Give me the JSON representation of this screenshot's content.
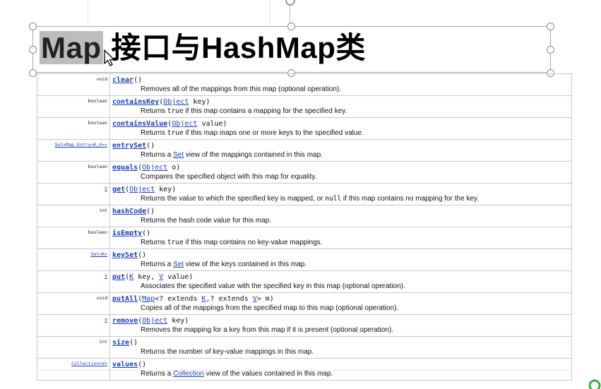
{
  "slide": {
    "title_selected": "Map",
    "title_rest": " 接口与HashMap类"
  },
  "methods": [
    {
      "type": "void",
      "name": "clear",
      "sig_before": "()",
      "desc": "Removes all of the mappings from this map (optional operation)."
    },
    {
      "type": "boolean",
      "name": "containsKey",
      "params": [
        {
          "t": "(",
          "plain": true
        },
        {
          "t": "Object",
          "link": true
        },
        {
          "t": " key)",
          "plain": true
        }
      ],
      "desc_parts": [
        {
          "t": "Returns "
        },
        {
          "t": "true",
          "code": true
        },
        {
          "t": " if this map contains a mapping for the specified key."
        }
      ]
    },
    {
      "type": "boolean",
      "name": "containsValue",
      "params": [
        {
          "t": "(",
          "plain": true
        },
        {
          "t": "Object",
          "link": true
        },
        {
          "t": " value)",
          "plain": true
        }
      ],
      "desc_parts": [
        {
          "t": "Returns "
        },
        {
          "t": "true",
          "code": true
        },
        {
          "t": " if this map maps one or more keys to the specified value."
        }
      ]
    },
    {
      "type": "Set<Map.Entry<K,V>>",
      "type_link": true,
      "name": "entrySet",
      "sig_before": "()",
      "desc_parts": [
        {
          "t": "Returns a "
        },
        {
          "t": "Set",
          "link": true
        },
        {
          "t": " view of the mappings contained in this map."
        }
      ]
    },
    {
      "type": "boolean",
      "name": "equals",
      "params": [
        {
          "t": "(",
          "plain": true
        },
        {
          "t": "Object",
          "link": true
        },
        {
          "t": " o)",
          "plain": true
        }
      ],
      "desc": "Compares the specified object with this map for equality."
    },
    {
      "type": "V",
      "type_link": true,
      "name": "get",
      "params": [
        {
          "t": "(",
          "plain": true
        },
        {
          "t": "Object",
          "link": true
        },
        {
          "t": " key)",
          "plain": true
        }
      ],
      "desc_parts": [
        {
          "t": "Returns the value to which the specified key is mapped, or "
        },
        {
          "t": "null",
          "code": true
        },
        {
          "t": " if this map contains no mapping for the key."
        }
      ]
    },
    {
      "type": "int",
      "name": "hashCode",
      "sig_before": "()",
      "desc": "Returns the hash code value for this map."
    },
    {
      "type": "boolean",
      "name": "isEmpty",
      "sig_before": "()",
      "desc_parts": [
        {
          "t": "Returns "
        },
        {
          "t": "true",
          "code": true
        },
        {
          "t": " if this map contains no key-value mappings."
        }
      ]
    },
    {
      "type": "Set<K>",
      "type_link": true,
      "name": "keySet",
      "sig_before": "()",
      "desc_parts": [
        {
          "t": "Returns a "
        },
        {
          "t": "Set",
          "link": true
        },
        {
          "t": " view of the keys contained in this map."
        }
      ]
    },
    {
      "type": "V",
      "type_link": true,
      "name": "put",
      "params": [
        {
          "t": "(",
          "plain": true
        },
        {
          "t": "K",
          "link": true
        },
        {
          "t": " key, ",
          "plain": true
        },
        {
          "t": "V",
          "link": true
        },
        {
          "t": " value)",
          "plain": true
        }
      ],
      "desc": "Associates the specified value with the specified key in this map (optional operation)."
    },
    {
      "type": "void",
      "name": "putAll",
      "params": [
        {
          "t": "(",
          "plain": true
        },
        {
          "t": "Map",
          "link": true
        },
        {
          "t": "<? extends ",
          "plain": true
        },
        {
          "t": "K",
          "link": true
        },
        {
          "t": ",? extends ",
          "plain": true
        },
        {
          "t": "V",
          "link": true
        },
        {
          "t": "> m)",
          "plain": true
        }
      ],
      "desc": "Copies all of the mappings from the specified map to this map (optional operation)."
    },
    {
      "type": "V",
      "type_link": true,
      "name": "remove",
      "params": [
        {
          "t": "(",
          "plain": true
        },
        {
          "t": "Object",
          "link": true
        },
        {
          "t": " key)",
          "plain": true
        }
      ],
      "desc": "Removes the mapping for a key from this map if it is present (optional operation)."
    },
    {
      "type": "int",
      "name": "size",
      "sig_before": "()",
      "desc": "Returns the number of key-value mappings in this map."
    },
    {
      "type": "Collection<V>",
      "type_link": true,
      "name": "values",
      "sig_before": "()",
      "desc_parts": [
        {
          "t": "Returns a "
        },
        {
          "t": "Collection",
          "link": true
        },
        {
          "t": " view of the values contained in this map."
        }
      ]
    }
  ],
  "colors": {
    "link": "#1a3fb3",
    "selection": "#bdbdbd",
    "border": "#c9c9c9"
  },
  "icons": [
    "mouse-cursor-icon",
    "rotate-handle-icon",
    "app-logo-icon"
  ]
}
